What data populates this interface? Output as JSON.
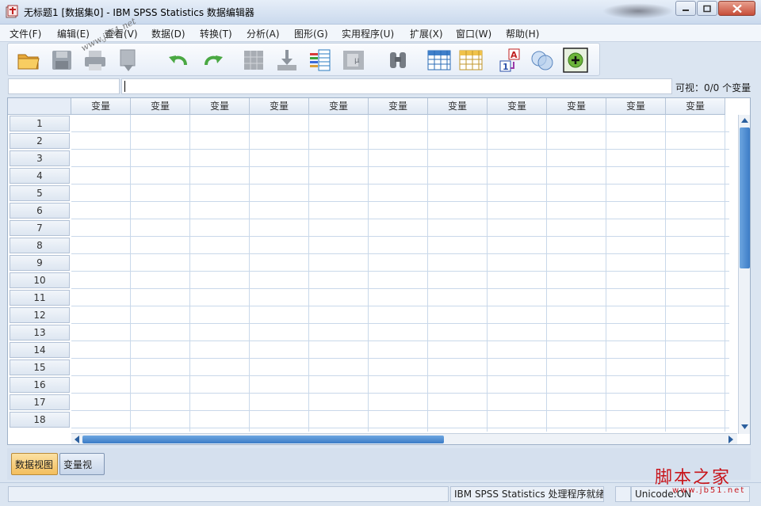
{
  "window": {
    "title": "无标题1 [数据集0] - IBM SPSS Statistics 数据编辑器",
    "icon": "spss-app-icon"
  },
  "menu": [
    "文件(F)",
    "编辑(E)",
    "查看(V)",
    "数据(D)",
    "转换(T)",
    "分析(A)",
    "图形(G)",
    "实用程序(U)",
    "扩展(X)",
    "窗口(W)",
    "帮助(H)"
  ],
  "toolbar": {
    "watermark": "www.jb51.net",
    "icons": [
      "open-folder-icon",
      "save-icon",
      "print-icon",
      "dialog-recall-icon",
      "undo-icon",
      "redo-icon",
      "goto-case-icon",
      "goto-variable-icon",
      "variables-icon",
      "run-descriptive-icon",
      "find-icon",
      "insert-cases-icon",
      "split-file-icon",
      "value-labels-icon",
      "use-variable-sets-icon",
      "show-all-variables-icon"
    ]
  },
  "editor": {
    "cell_reference": "",
    "cell_value": "",
    "visible_label": "可视：0/0 个变量"
  },
  "grid": {
    "column_header": "变量",
    "columns": [
      "变量",
      "变量",
      "变量",
      "变量",
      "变量",
      "变量",
      "变量",
      "变量",
      "变量",
      "变量",
      "变量"
    ],
    "rows": [
      "1",
      "2",
      "3",
      "4",
      "5",
      "6",
      "7",
      "8",
      "9",
      "10",
      "11",
      "12",
      "13",
      "14",
      "15",
      "16",
      "17",
      "18"
    ]
  },
  "tabs": {
    "data_view": "数据视图",
    "variable_view": "变量视图",
    "active": "数据视图"
  },
  "status": {
    "processor": "IBM SPSS Statistics 处理程序就绪",
    "encoding": "Unicode:ON"
  },
  "site_brand": {
    "name": "脚本之家",
    "url": "www.jb51.net"
  },
  "colors": {
    "accent": "#3c7cc6",
    "active_tab": "#f3be5d",
    "brand": "#c8151b"
  }
}
